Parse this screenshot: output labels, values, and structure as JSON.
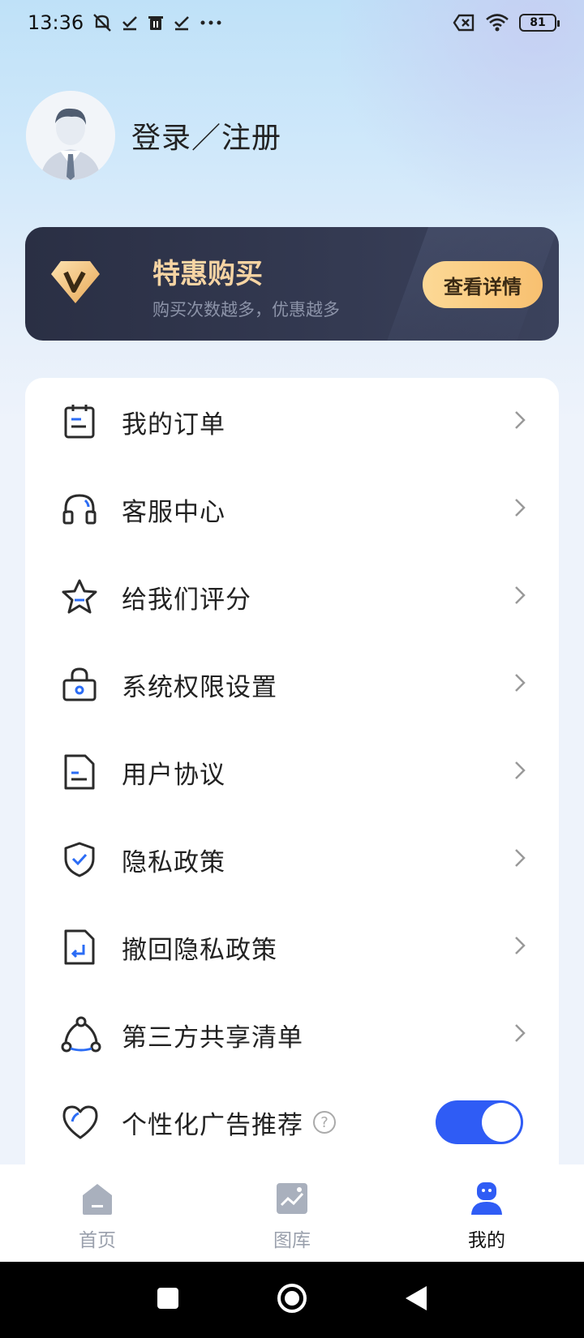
{
  "status_bar": {
    "time": "13:36",
    "battery": "81"
  },
  "profile": {
    "login_label": "登录／注册"
  },
  "vip": {
    "title": "特惠购买",
    "subtitle": "购买次数越多，优惠越多",
    "button": "查看详情"
  },
  "menu": {
    "items": [
      {
        "label": "我的订单",
        "icon": "order-icon"
      },
      {
        "label": "客服中心",
        "icon": "headset-icon"
      },
      {
        "label": "给我们评分",
        "icon": "star-icon"
      },
      {
        "label": "系统权限设置",
        "icon": "lock-icon"
      },
      {
        "label": "用户协议",
        "icon": "document-icon"
      },
      {
        "label": "隐私政策",
        "icon": "shield-icon"
      },
      {
        "label": "撤回隐私政策",
        "icon": "revoke-document-icon"
      },
      {
        "label": "第三方共享清单",
        "icon": "share-icon"
      },
      {
        "label": "个性化广告推荐",
        "icon": "heart-icon"
      }
    ],
    "ad_toggle_on": true
  },
  "bottom_nav": {
    "items": [
      {
        "label": "首页",
        "icon": "home-icon"
      },
      {
        "label": "图库",
        "icon": "gallery-icon"
      },
      {
        "label": "我的",
        "icon": "profile-icon"
      }
    ],
    "active": "我的"
  },
  "colors": {
    "accent": "#2f5cf5",
    "vip_gold": "#f6d4a3",
    "banner_dark": "#2a2f44"
  }
}
